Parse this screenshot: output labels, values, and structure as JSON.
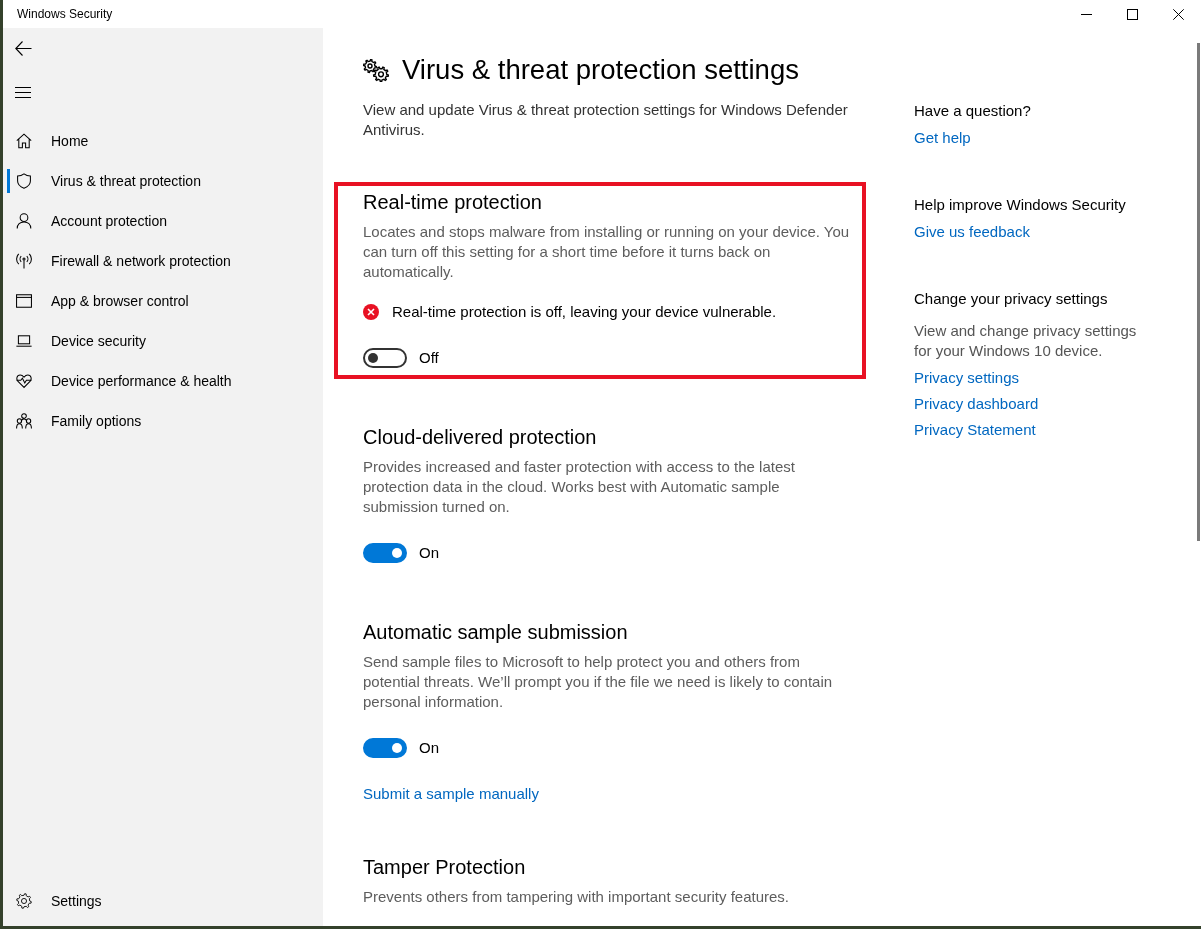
{
  "window": {
    "title": "Windows Security"
  },
  "sidebar": {
    "items": [
      {
        "label": "Home",
        "selected": false
      },
      {
        "label": "Virus & threat protection",
        "selected": true
      },
      {
        "label": "Account protection",
        "selected": false
      },
      {
        "label": "Firewall & network protection",
        "selected": false
      },
      {
        "label": "App & browser control",
        "selected": false
      },
      {
        "label": "Device security",
        "selected": false
      },
      {
        "label": "Device performance & health",
        "selected": false
      },
      {
        "label": "Family options",
        "selected": false
      }
    ],
    "footer_item": {
      "label": "Settings",
      "selected": false
    }
  },
  "page": {
    "title": "Virus & threat protection settings",
    "description": "View and update Virus & threat protection settings for Windows Defender Antivirus."
  },
  "sections": [
    {
      "title": "Real-time protection",
      "description": "Locates and stops malware from installing or running on your device. You can turn off this setting for a short time before it turns back on automatically.",
      "highlighted": true,
      "warning": "Real-time protection is off, leaving your device vulnerable.",
      "toggle": {
        "on": false,
        "label": "Off"
      }
    },
    {
      "title": "Cloud-delivered protection",
      "description": "Provides increased and faster protection with access to the latest protection data in the cloud. Works best with Automatic sample submission turned on.",
      "highlighted": false,
      "toggle": {
        "on": true,
        "label": "On"
      }
    },
    {
      "title": "Automatic sample submission",
      "description": "Send sample files to Microsoft to help protect you and others from potential threats. We’ll prompt you if the file we need is likely to contain personal information.",
      "highlighted": false,
      "toggle": {
        "on": true,
        "label": "On"
      },
      "link": "Submit a sample manually"
    },
    {
      "title": "Tamper Protection",
      "description": "Prevents others from tampering with important security features.",
      "highlighted": false
    }
  ],
  "aside": {
    "groups": [
      {
        "heading": "Have a question?",
        "links": [
          "Get help"
        ]
      },
      {
        "heading": "Help improve Windows Security",
        "links": [
          "Give us feedback"
        ]
      },
      {
        "heading": "Change your privacy settings",
        "description": "View and change privacy settings for your Windows 10 device.",
        "links": [
          "Privacy settings",
          "Privacy dashboard",
          "Privacy Statement"
        ]
      }
    ]
  }
}
